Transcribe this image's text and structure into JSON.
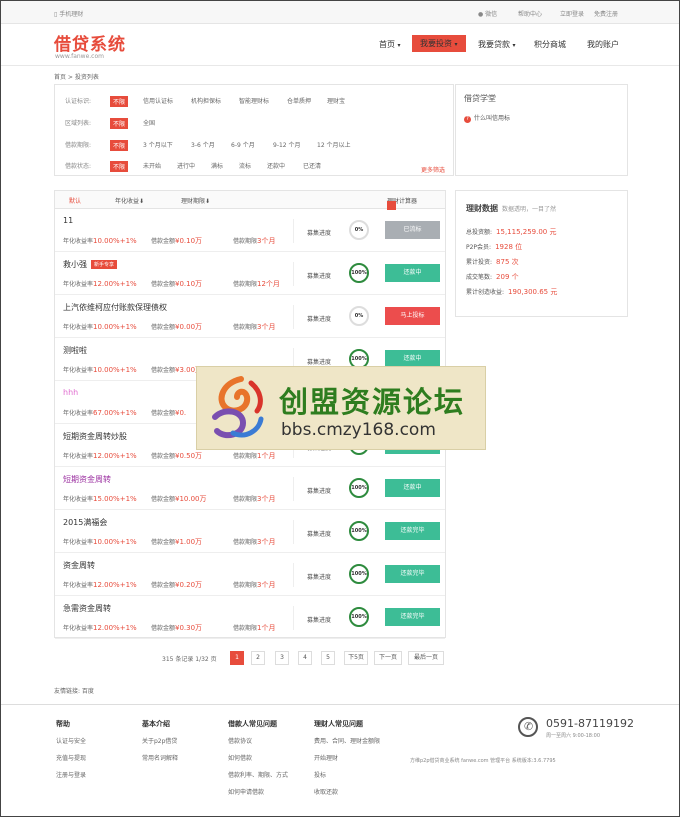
{
  "topbar": {
    "mobile": "手机理财",
    "wechat": "微信",
    "help": "帮助中心",
    "login": "立即登录",
    "register": "免费注册"
  },
  "header": {
    "logo": "借贷系统",
    "logo_url": "www.fanwe.com",
    "nav": [
      {
        "label": "首页",
        "caret": "▾"
      },
      {
        "label": "我要投资",
        "caret": "▾"
      },
      {
        "label": "我要贷款",
        "caret": "▾"
      },
      {
        "label": "积分商城"
      },
      {
        "label": "我的账户"
      }
    ]
  },
  "breadcrumb": "首页 > 投资列表",
  "filter": {
    "rows": [
      {
        "label": "认证标识:",
        "selected": "不限",
        "options": [
          "信用认证标",
          "机构担保标",
          "智能理财标",
          "仓单质押",
          "理财宝"
        ]
      },
      {
        "label": "区域列表:",
        "selected": "不限",
        "options": [
          "全国"
        ]
      },
      {
        "label": "借款期限:",
        "selected": "不限",
        "options": [
          "3 个月以下",
          "3-6 个月",
          "6-9 个月",
          "9-12 个月",
          "12 个月以上"
        ]
      },
      {
        "label": "借款状态:",
        "selected": "不限",
        "options": [
          "未开始",
          "进行中",
          "满标",
          "流标",
          "还款中",
          "已还清"
        ]
      }
    ],
    "more": "更多筛选"
  },
  "school": {
    "title": "借贷学堂",
    "question": "什么叫信用标"
  },
  "list": {
    "sort_default": "默认",
    "sort_rate": "年化收益",
    "sort_term": "理财期限",
    "calculator": "理财计算器",
    "progress_label": "募集进度",
    "rate_prefix": "年化收益率",
    "amount_prefix": "借款金额",
    "term_prefix": "借款期限",
    "items": [
      {
        "title": "11",
        "tag": "",
        "rate": "10.00%+1%",
        "amount": "¥0.10万",
        "term": "3个月",
        "progress": "0%",
        "full": false,
        "button": "已流标",
        "btype": "gray"
      },
      {
        "title": "救小强",
        "tag": "新手专享",
        "rate": "12.00%+1%",
        "amount": "¥0.10万",
        "term": "12个月",
        "progress": "100%",
        "full": true,
        "button": "还款中",
        "btype": "green"
      },
      {
        "title": "上汽依维柯应付账款保理债权",
        "tag": "",
        "rate": "10.00%+1%",
        "amount": "¥0.00万",
        "term": "3个月",
        "progress": "0%",
        "full": false,
        "button": "马上投标",
        "btype": "redb"
      },
      {
        "title": "测啦啦",
        "tag": "",
        "rate": "10.00%+1%",
        "amount": "¥3.00万",
        "term": "3个月",
        "progress": "100%",
        "full": true,
        "button": "还款中",
        "btype": "green"
      },
      {
        "title": "hhh",
        "tag": "",
        "rate": "67.00%+1%",
        "amount": "¥0.",
        "term": "",
        "progress": "100%",
        "full": true,
        "button": "还款中",
        "btype": "green",
        "pink": true
      },
      {
        "title": "短期资金周转炒股",
        "tag": "",
        "rate": "12.00%+1%",
        "amount": "¥0.50万",
        "term": "1个月",
        "progress": "100%",
        "full": true,
        "button": "还款中",
        "btype": "green"
      },
      {
        "title": "短期资金周转",
        "tag": "",
        "rate": "15.00%+1%",
        "amount": "¥10.00万",
        "term": "3个月",
        "progress": "100%",
        "full": true,
        "button": "还款中",
        "btype": "green",
        "purple": true
      },
      {
        "title": "2015满福会",
        "tag": "",
        "rate": "10.00%+1%",
        "amount": "¥1.00万",
        "term": "3个月",
        "progress": "100%",
        "full": true,
        "button": "还款完毕",
        "btype": "green"
      },
      {
        "title": "资金周转",
        "tag": "",
        "rate": "12.00%+1%",
        "amount": "¥0.20万",
        "term": "3个月",
        "progress": "100%",
        "full": true,
        "button": "还款完毕",
        "btype": "green"
      },
      {
        "title": "急需资金周转",
        "tag": "",
        "rate": "12.00%+1%",
        "amount": "¥0.30万",
        "term": "1个月",
        "progress": "100%",
        "full": true,
        "button": "还款完毕",
        "btype": "green"
      }
    ]
  },
  "pager": {
    "summary": "315 条记录 1/32 页",
    "pages": [
      "1",
      "2",
      "3",
      "4",
      "5"
    ],
    "next5": "下5页",
    "next": "下一页",
    "last": "最后一页"
  },
  "stats": {
    "title": "理财数据",
    "subtitle": "数据透明，一目了然",
    "rows": [
      {
        "label": "总投资额:",
        "value": "15,115,259.00 元"
      },
      {
        "label": "P2P会员:",
        "value": "1928 位"
      },
      {
        "label": "累计投资:",
        "value": "875 次"
      },
      {
        "label": "成交笔数:",
        "value": "209 个"
      },
      {
        "label": "累计创造收益:",
        "value": "190,300.65 元"
      }
    ]
  },
  "watermark": {
    "title": "创盟资源论坛",
    "url": "bbs.cmzy168.com"
  },
  "friend_links": "友情链接: 百度",
  "footer": {
    "cols": [
      {
        "title": "帮助",
        "items": [
          "认证与安全",
          "充值与提现",
          "注册与登录"
        ]
      },
      {
        "title": "基本介绍",
        "items": [
          "关于p2p借贷",
          "常用名词解释"
        ]
      },
      {
        "title": "借款人常见问题",
        "items": [
          "借款协议",
          "如何借款",
          "借款利率、期限、方式",
          "如何申请借款"
        ]
      },
      {
        "title": "理财人常见问题",
        "items": [
          "费用、合同、理财金额限",
          "开始理财",
          "投标",
          "收取还款"
        ]
      }
    ],
    "phone": "0591-87119192",
    "hours": "周一至周六 9:00-18:00",
    "copyright": "方维p2p借贷商业系统 fanwe.com 管理平台 系统版本:3.6.7795",
    "accent": "#e74c3c"
  }
}
